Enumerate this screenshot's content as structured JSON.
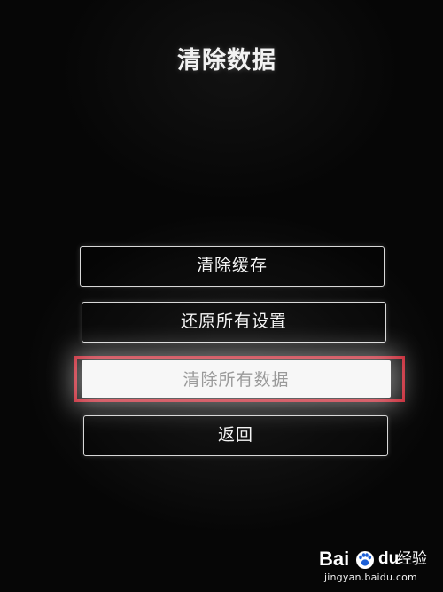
{
  "screen": {
    "title": "清除数据"
  },
  "menu": {
    "items": [
      {
        "label": "清除缓存"
      },
      {
        "label": "还原所有设置"
      },
      {
        "label": "清除所有数据",
        "selected": true
      },
      {
        "label": "返回"
      }
    ]
  },
  "highlight": {
    "color": "#c4202e"
  },
  "watermark": {
    "brand_left": "Bai",
    "brand_right": "du",
    "brand_suffix": "经验",
    "url": "jingyan.baidu.com",
    "icon": "paw-icon"
  }
}
